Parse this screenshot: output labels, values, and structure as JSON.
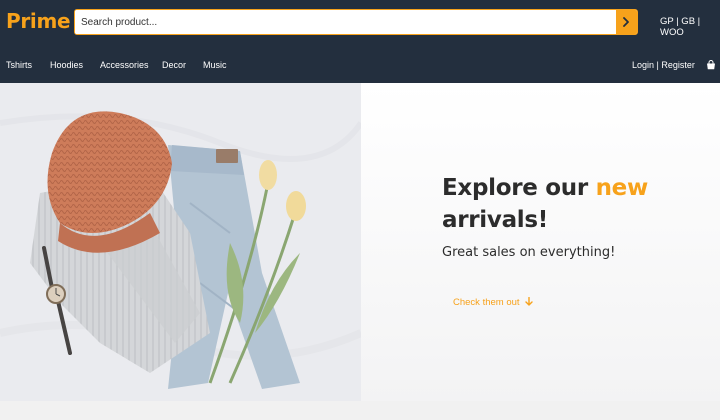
{
  "header": {
    "logo": "Prime",
    "search": {
      "placeholder": "Search product...",
      "value": ""
    },
    "search_button_icon": "chevron-right-icon",
    "sites_label": "GP | GB | WOO"
  },
  "nav": {
    "items": [
      {
        "label": "Tshirts"
      },
      {
        "label": "Hoodies"
      },
      {
        "label": "Accessories"
      },
      {
        "label": "Decor"
      },
      {
        "label": "Music"
      }
    ],
    "login": "Login",
    "separator": "|",
    "register": "Register",
    "cart_icon": "shopping-bag-icon"
  },
  "hero": {
    "title_part1": "Explore our ",
    "title_highlight": "new",
    "title_part2": "arrivals!",
    "subtitle": "Great sales on everything!",
    "cta_label": "Check them out",
    "cta_icon": "arrow-down-icon"
  },
  "colors": {
    "header_bg": "#232f3e",
    "accent": "#f7a21b",
    "text_dark": "#2c2c2c"
  }
}
